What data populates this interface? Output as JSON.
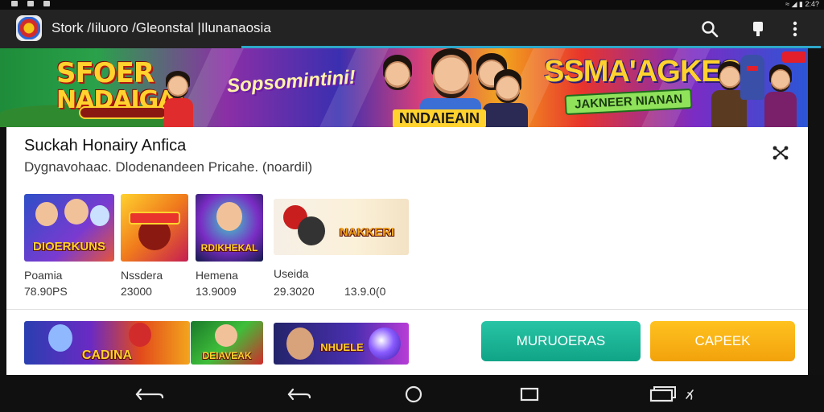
{
  "status_bar": {
    "right_text": "≈ ◢ ▮ 2:4?"
  },
  "app_bar": {
    "title": "Stork /Iiluoro /Gleonstal |Ilunanaosia",
    "search_icon": "search-icon",
    "bookmark_icon": "bookmark-icon",
    "menu_icon": "more-vert-icon",
    "accent_color": "#2ea6c9"
  },
  "banner": {
    "left_logo_line1": "SFOER",
    "left_logo_line2": "NADAIGAL",
    "script_text": "Sopsomintini!",
    "center_text": "NNDAIEAIN",
    "right_logo": "SSMA'AGKES",
    "right_sub": "JAKNEER NIANAN"
  },
  "section": {
    "title": "Suckah Honairy Anfica",
    "subtitle": "Dygnavohaac. Dlodenandeen Pricahe. (noardil)",
    "share_icon": "share-icon"
  },
  "games": [
    {
      "tile_text": "DIOERKUNS",
      "name": "Poamia",
      "price": "78.90PS"
    },
    {
      "tile_text": "",
      "name": "Nssdera",
      "price": "23000"
    },
    {
      "tile_text": "RDIKHEKAL",
      "name": "Hemena",
      "price": "13.9009"
    },
    {
      "tile_text": "NAKKERI",
      "name": "Useida",
      "price": "29.3020"
    }
  ],
  "extra_price": "13.9.0(0",
  "row2_tiles": [
    {
      "tile_text": "CADINA"
    },
    {
      "tile_text": "DEIAVEAK"
    },
    {
      "tile_text": "NHUELE"
    }
  ],
  "buttons": {
    "primary_label": "MURUOERAS",
    "secondary_label": "CAPEEK",
    "primary_color": "#14a98c",
    "secondary_color": "#f6ab12"
  },
  "nav_bar": {
    "back_icon": "back-icon",
    "back_alt_icon": "back-icon",
    "home_icon": "home-circle-icon",
    "recents_icon": "recents-square-icon",
    "multiwindow_icon": "multiwindow-icon"
  }
}
